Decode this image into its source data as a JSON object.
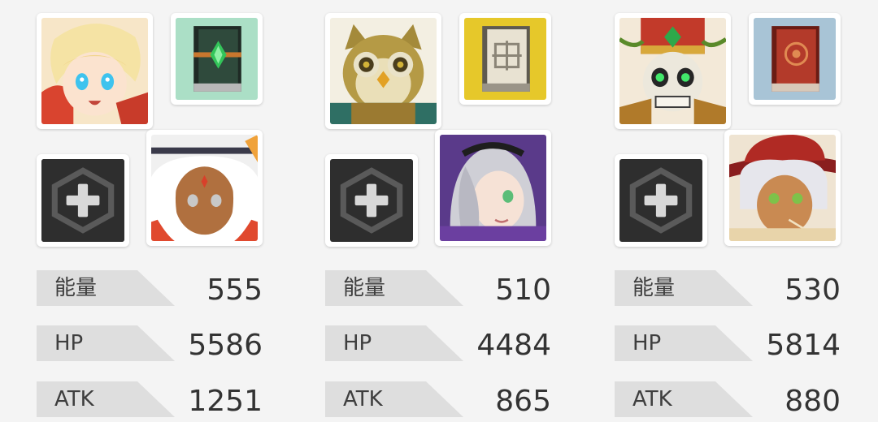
{
  "teams": [
    {
      "leader_portrait": "blonde-girl-portrait-icon",
      "book_icon": "green-gem-tome-icon",
      "empty_slot_icon": "add-slot-icon",
      "support_portrait": "white-hair-girl-portrait-icon",
      "stats": [
        {
          "label": "能量",
          "value": "555"
        },
        {
          "label": "HP",
          "value": "5586"
        },
        {
          "label": "ATK",
          "value": "1251"
        }
      ]
    },
    {
      "leader_portrait": "owl-portrait-icon",
      "book_icon": "grey-rune-tome-icon",
      "empty_slot_icon": "add-slot-icon",
      "support_portrait": "silver-hair-girl-portrait-icon",
      "stats": [
        {
          "label": "能量",
          "value": "510"
        },
        {
          "label": "HP",
          "value": "4484"
        },
        {
          "label": "ATK",
          "value": "865"
        }
      ]
    },
    {
      "leader_portrait": "skull-king-portrait-icon",
      "book_icon": "red-tome-icon",
      "empty_slot_icon": "add-slot-icon",
      "support_portrait": "cowboy-hat-portrait-icon",
      "stats": [
        {
          "label": "能量",
          "value": "530"
        },
        {
          "label": "HP",
          "value": "5814"
        },
        {
          "label": "ATK",
          "value": "880"
        }
      ]
    }
  ],
  "colors": {
    "background": "#f4f4f4",
    "stat_tab": "#dedede",
    "text": "#333333",
    "slot_dark": "#2e2e2e"
  }
}
